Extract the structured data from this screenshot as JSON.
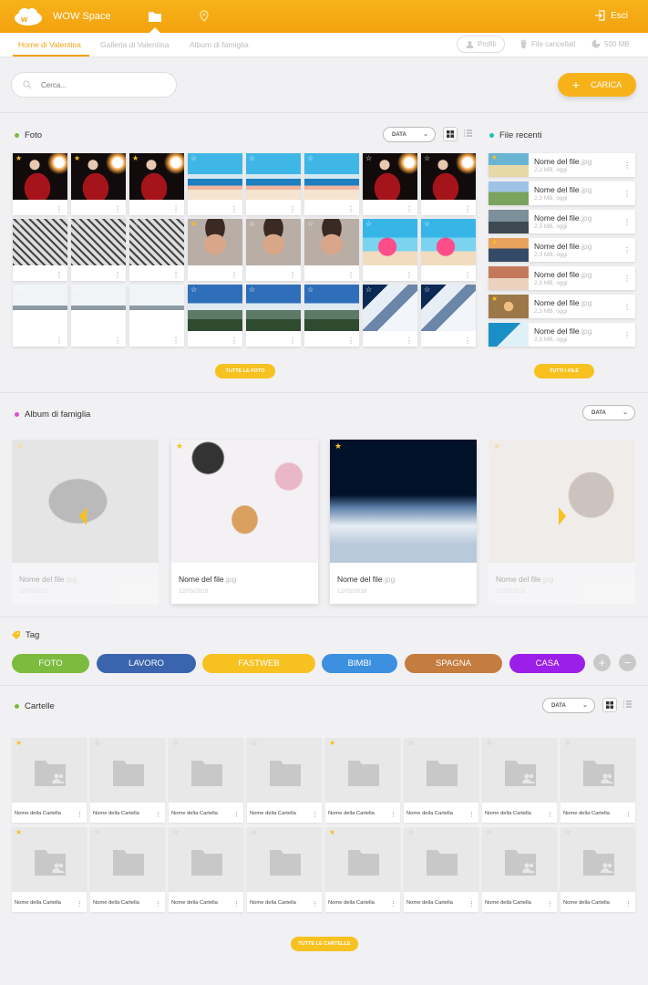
{
  "header": {
    "brand": "WOW Space",
    "exit": "Esci"
  },
  "tabs": [
    {
      "label": "Home di Valentina",
      "active": true
    },
    {
      "label": "Galleria di Valentina"
    },
    {
      "label": "Album di famiglia"
    }
  ],
  "subnav": {
    "profiles": "Profili",
    "deleted": "File cancellati",
    "storage": "500 MB"
  },
  "search": {
    "placeholder": "Cerca..."
  },
  "upload": {
    "label": "CARICA"
  },
  "photos": {
    "title": "Foto",
    "sort": "DATA",
    "more_button": "TUTTE LE FOTO",
    "grid": [
      [
        "woman",
        "woman",
        "woman",
        "boat",
        "boat",
        "boat",
        "woman",
        "woman"
      ],
      [
        "astronaut",
        "astronaut",
        "astronaut",
        "baby",
        "baby",
        "baby",
        "flamingo",
        "flamingo"
      ],
      [
        "snow",
        "snow",
        "snow",
        "mountain",
        "mountain",
        "mountain",
        "glacier",
        "glacier"
      ]
    ],
    "starred": [
      [
        true,
        true,
        true,
        false,
        false,
        false,
        false,
        false
      ],
      [
        false,
        false,
        false,
        true,
        false,
        false,
        false,
        false
      ],
      [
        false,
        false,
        false,
        false,
        false,
        false,
        false,
        false
      ]
    ]
  },
  "recent": {
    "title": "File recenti",
    "more_button": "TUTTI I FILE",
    "items": [
      {
        "name": "Nome del file",
        "ext": ".jpg",
        "meta": "2,3 MB, oggi",
        "thumb": "beach",
        "starred": true
      },
      {
        "name": "Nome del file",
        "ext": ".jpg",
        "meta": "2,3 MB, oggi",
        "thumb": "picnic",
        "starred": false
      },
      {
        "name": "Nome del file",
        "ext": ".jpg",
        "meta": "2,3 MB, oggi",
        "thumb": "rocks",
        "starred": false
      },
      {
        "name": "Nome del file",
        "ext": ".jpg",
        "meta": "2,3 MB, oggi",
        "thumb": "sunset",
        "starred": true
      },
      {
        "name": "Nome del file",
        "ext": ".jpg",
        "meta": "2,3 MB, oggi",
        "thumb": "girl",
        "starred": false
      },
      {
        "name": "Nome del file",
        "ext": ".jpg",
        "meta": "2,3 MB, oggi",
        "thumb": "starfish",
        "starred": true
      },
      {
        "name": "Nome del file",
        "ext": ".jpg",
        "meta": "2,3 MB, oggi",
        "thumb": "sea",
        "starred": false
      }
    ]
  },
  "album": {
    "title": "Album di famiglia",
    "sort": "DATA",
    "items": [
      {
        "name": "Nome del file",
        "ext": ".jpg",
        "date": "12/05/2018",
        "thumb": "mother",
        "faded": true
      },
      {
        "name": "Nome del file",
        "ext": ".jpg",
        "date": "12/05/2018",
        "thumb": "flatlay",
        "faded": false
      },
      {
        "name": "Nome del file",
        "ext": ".jpg",
        "date": "12/05/2018",
        "thumb": "clouds",
        "faded": false
      },
      {
        "name": "Nome del file",
        "ext": ".jpg",
        "date": "12/05/2018",
        "thumb": "father",
        "faded": true
      }
    ]
  },
  "tags": {
    "title": "Tag",
    "items": [
      {
        "label": "FOTO",
        "color": "#7cbb3d"
      },
      {
        "label": "LAVORO",
        "color": "#3b64ae"
      },
      {
        "label": "FASTWEB",
        "color": "#f7c120"
      },
      {
        "label": "BIMBI",
        "color": "#3d8fe0"
      },
      {
        "label": "SPAGNA",
        "color": "#c57c3f"
      },
      {
        "label": "CASA",
        "color": "#9b1fe8"
      }
    ]
  },
  "folders": {
    "title": "Cartelle",
    "sort": "DATA",
    "more_button": "TUTTE LE CARTELLE",
    "rows": [
      [
        {
          "name": "Nome della Cartella",
          "starred": true,
          "shared": true
        },
        {
          "name": "Nome della Cartella",
          "starred": false,
          "shared": false
        },
        {
          "name": "Nome della Cartella",
          "starred": false,
          "shared": false
        },
        {
          "name": "Nome della Cartella",
          "starred": false,
          "shared": false
        },
        {
          "name": "Nome della Cartella",
          "starred": true,
          "shared": false
        },
        {
          "name": "Nome della Cartella",
          "starred": false,
          "shared": false
        },
        {
          "name": "Nome della Cartella",
          "starred": false,
          "shared": true
        },
        {
          "name": "Nome della Cartella",
          "starred": false,
          "shared": true
        }
      ],
      [
        {
          "name": "Nome della Cartella",
          "starred": true,
          "shared": true
        },
        {
          "name": "Nome della Cartella",
          "starred": false,
          "shared": false
        },
        {
          "name": "Nome della Cartella",
          "starred": false,
          "shared": false
        },
        {
          "name": "Nome della Cartella",
          "starred": false,
          "shared": false
        },
        {
          "name": "Nome della Cartella",
          "starred": true,
          "shared": false
        },
        {
          "name": "Nome della Cartella",
          "starred": false,
          "shared": false
        },
        {
          "name": "Nome della Cartella",
          "starred": false,
          "shared": true
        },
        {
          "name": "Nome della Cartella",
          "starred": false,
          "shared": true
        }
      ]
    ]
  },
  "colors": {
    "accent": "#f3a20f",
    "button": "#f7c120",
    "foto_dot": "#7cbb3d",
    "recent_dot": "#21c0b4",
    "album_dot": "#e04fd0",
    "folder_dot": "#7cbb3d"
  }
}
